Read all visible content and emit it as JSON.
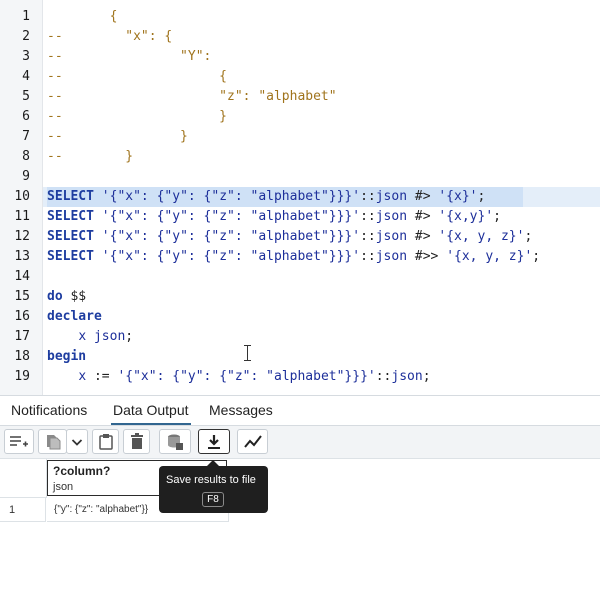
{
  "editor": {
    "lines": [
      "        {",
      "--        \"x\": {",
      "--               \"Y\":",
      "--                    {",
      "--                    \"z\": \"alphabet\"",
      "--                    }",
      "--               }",
      "--        }",
      "",
      "SELECT '{\"x\": {\"y\": {\"z\": \"alphabet\"}}}'::json #> '{x}';",
      "SELECT '{\"x\": {\"y\": {\"z\": \"alphabet\"}}}'::json #> '{x,y}';",
      "SELECT '{\"x\": {\"y\": {\"z\": \"alphabet\"}}}'::json #> '{x, y, z}';",
      "SELECT '{\"x\": {\"y\": {\"z\": \"alphabet\"}}}'::json #>> '{x, y, z}';",
      "",
      "do $$",
      "declare",
      "    x json;",
      "begin",
      "    x := '{\"x\": {\"y\": {\"z\": \"alphabet\"}}}'::json;"
    ]
  },
  "tabs": [
    "Notifications",
    "Data Output",
    "Messages"
  ],
  "active_tab": "Data Output",
  "toolbar": {
    "buttons": [
      "add-row-icon",
      "copy-icon",
      "chevron-down-icon",
      "paste-icon",
      "delete-icon",
      "save-data-icon",
      "download-icon",
      "graph-icon"
    ]
  },
  "grid": {
    "column_name": "?column?",
    "column_type": "json",
    "rows": [
      {
        "num": "1",
        "value": "{\"y\": {\"z\": \"alphabet\"}}"
      }
    ]
  },
  "tooltip": {
    "text": "Save results to file",
    "shortcut": "F8"
  }
}
